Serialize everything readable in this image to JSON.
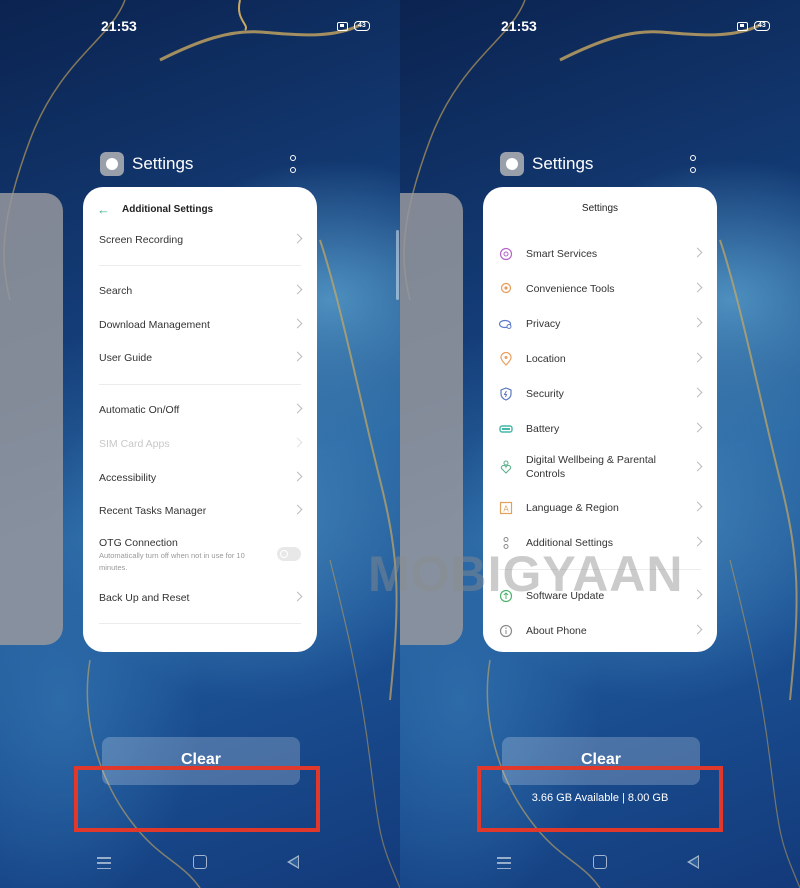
{
  "left": {
    "status": {
      "time": "21:53",
      "battery": "43"
    },
    "app": {
      "title": "Settings",
      "icon": "gear-icon"
    },
    "card": {
      "header": "Additional Settings",
      "items": [
        {
          "label": "Screen Recording"
        },
        {
          "label": "Search"
        },
        {
          "label": "Download Management"
        },
        {
          "label": "User Guide"
        },
        {
          "label": "Automatic On/Off"
        },
        {
          "label": "SIM Card Apps",
          "disabled": true
        },
        {
          "label": "Accessibility"
        },
        {
          "label": "Recent Tasks Manager"
        },
        {
          "label": "OTG Connection",
          "subtitle": "Automatically turn off when not in use for 10 minutes.",
          "toggle": "off"
        },
        {
          "label": "Back Up and Reset"
        }
      ]
    },
    "clear_label": "Clear"
  },
  "right": {
    "status": {
      "time": "21:53",
      "battery": "43"
    },
    "app": {
      "title": "Settings",
      "icon": "gear-icon"
    },
    "card": {
      "title": "Settings",
      "items": [
        {
          "label": "Smart Services",
          "icon": "smart-services-icon",
          "color": "#b565c9"
        },
        {
          "label": "Convenience Tools",
          "icon": "convenience-tools-icon",
          "color": "#e79a55"
        },
        {
          "label": "Privacy",
          "icon": "privacy-icon",
          "color": "#5b7bc8"
        },
        {
          "label": "Location",
          "icon": "location-icon",
          "color": "#e9a060"
        },
        {
          "label": "Security",
          "icon": "security-icon",
          "color": "#5a78c0"
        },
        {
          "label": "Battery",
          "icon": "battery-icon",
          "color": "#46b7a8"
        },
        {
          "label": "Digital Wellbeing & Parental Controls",
          "icon": "wellbeing-icon",
          "color": "#5fb08a"
        },
        {
          "label": "Language & Region",
          "icon": "language-icon",
          "color": "#e3a05c"
        },
        {
          "label": "Additional Settings",
          "icon": "additional-settings-icon",
          "color": "#8a8a8a"
        },
        {
          "label": "Software Update",
          "icon": "software-update-icon",
          "color": "#4fb36f"
        },
        {
          "label": "About Phone",
          "icon": "info-icon",
          "color": "#8a8a8a"
        }
      ]
    },
    "clear_label": "Clear",
    "memory": "3.66 GB Available | 8.00 GB"
  },
  "watermark": "MOBIGYAAN",
  "highlight_color": "#e0392c"
}
